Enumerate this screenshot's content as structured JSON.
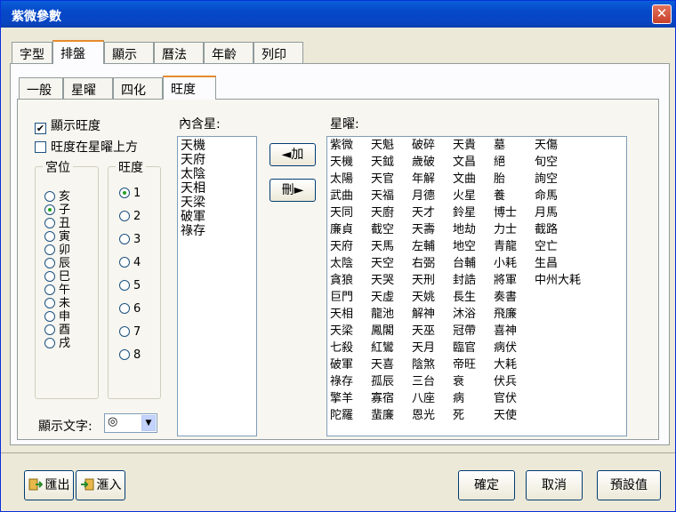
{
  "window": {
    "title": "紫微參數",
    "close_label": "✕"
  },
  "main_tabs": [
    "字型",
    "排盤",
    "顯示",
    "曆法",
    "年齡",
    "列印"
  ],
  "sub_tabs": [
    "一般",
    "星曜",
    "四化",
    "旺度"
  ],
  "options": {
    "show_brightness": "顯示旺度",
    "brightness_above_star": "旺度在星曜上方"
  },
  "palace_group": {
    "title": "宮位",
    "items": [
      "亥",
      "子",
      "丑",
      "寅",
      "卯",
      "辰",
      "巳",
      "午",
      "未",
      "申",
      "酉",
      "戌"
    ],
    "selected": "子"
  },
  "brightness_group": {
    "title": "旺度",
    "items": [
      "1",
      "2",
      "3",
      "4",
      "5",
      "6",
      "7",
      "8"
    ],
    "selected": "1"
  },
  "display_text": {
    "label": "顯示文字:",
    "value": "◎"
  },
  "contained_stars": {
    "label": "內含星:",
    "items": [
      "天機",
      "天府",
      "太陰",
      "天相",
      "天梁",
      "破軍",
      "祿存"
    ]
  },
  "buttons": {
    "add": "◄加",
    "delete": "刪►",
    "export": "匯出",
    "import": "滙入",
    "ok": "確定",
    "cancel": "取消",
    "default": "預設值"
  },
  "stars": {
    "label": "星曜:",
    "rows": [
      [
        "紫微",
        "天魁",
        "破碎",
        "天貴",
        "墓",
        "天傷"
      ],
      [
        "天機",
        "天鉞",
        "歲破",
        "文昌",
        "絕",
        "旬空"
      ],
      [
        "太陽",
        "天官",
        "年解",
        "文曲",
        "胎",
        "詢空"
      ],
      [
        "武曲",
        "天福",
        "月德",
        "火星",
        "養",
        "命馬"
      ],
      [
        "天同",
        "天廚",
        "天才",
        "鈴星",
        "博士",
        "月馬"
      ],
      [
        "廉貞",
        "截空",
        "天壽",
        "地劫",
        "力士",
        "截路"
      ],
      [
        "天府",
        "天馬",
        "左輔",
        "地空",
        "青龍",
        "空亡"
      ],
      [
        "太陰",
        "天空",
        "右弼",
        "台輔",
        "小耗",
        "生昌"
      ],
      [
        "貪狼",
        "天哭",
        "天刑",
        "封誥",
        "將軍",
        "中州大耗"
      ],
      [
        "巨門",
        "天虛",
        "天姚",
        "長生",
        "奏書",
        ""
      ],
      [
        "天相",
        "龍池",
        "解神",
        "沐浴",
        "飛廉",
        ""
      ],
      [
        "天梁",
        "鳳閣",
        "天巫",
        "冠帶",
        "喜神",
        ""
      ],
      [
        "七殺",
        "紅鸞",
        "天月",
        "臨官",
        "病伏",
        ""
      ],
      [
        "破軍",
        "天喜",
        "陰煞",
        "帝旺",
        "大耗",
        ""
      ],
      [
        "祿存",
        "孤辰",
        "三台",
        "衰",
        "伏兵",
        ""
      ],
      [
        "擎羊",
        "寡宿",
        "八座",
        "病",
        "官伏",
        ""
      ],
      [
        "陀羅",
        "蜚廉",
        "恩光",
        "死",
        "天使",
        ""
      ]
    ]
  },
  "colors": {
    "title_bar": "#0548c9",
    "tab_highlight": "#e68b2c"
  }
}
